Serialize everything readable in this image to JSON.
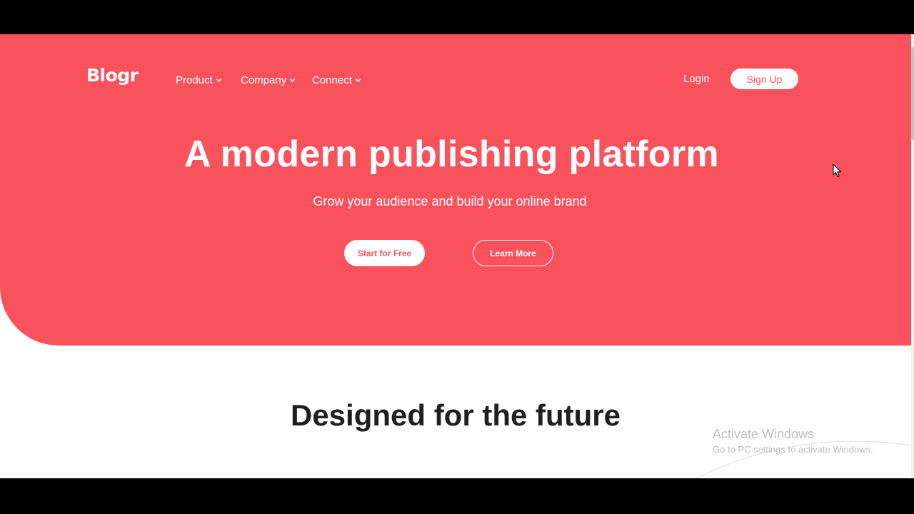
{
  "colors": {
    "brand": "#f9525d",
    "white": "#ffffff",
    "text_dark": "#1f1f1f"
  },
  "header": {
    "logo": "Blogr",
    "nav": [
      {
        "label": "Product",
        "icon": "chevron-down-icon"
      },
      {
        "label": "Company",
        "icon": "chevron-down-icon"
      },
      {
        "label": "Connect",
        "icon": "chevron-down-icon"
      }
    ],
    "login_label": "Login",
    "signup_label": "Sign Up"
  },
  "hero": {
    "title": "A modern publishing platform",
    "subtitle": "Grow your audience and build your online brand",
    "primary_button": "Start for Free",
    "secondary_button": "Learn More"
  },
  "section": {
    "title": "Designed for the future"
  },
  "overlay": {
    "activate_title": "Activate Windows",
    "activate_subtitle": "Go to PC settings to activate Windows."
  }
}
